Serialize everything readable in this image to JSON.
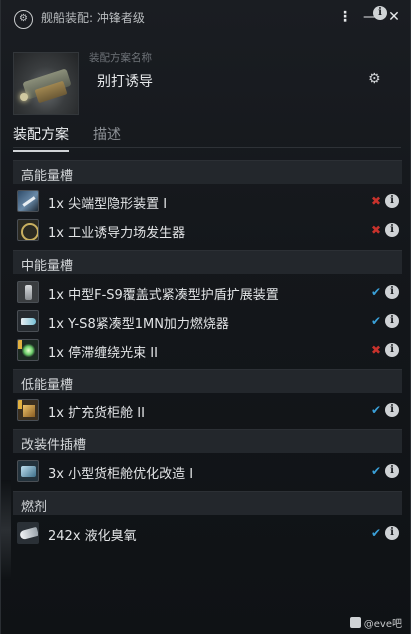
{
  "window": {
    "title": "舰船装配: 冲锋者级",
    "logo_icon": "fitting-icon"
  },
  "fit": {
    "label": "装配方案名称",
    "name": "别打诱导"
  },
  "tabs": [
    {
      "label": "装配方案",
      "active": true
    },
    {
      "label": "描述",
      "active": false
    }
  ],
  "sections": [
    {
      "title": "高能量槽",
      "items": [
        {
          "text": "1x 尖端型隐形装置 I",
          "icon": "cloak-icon",
          "status": "invalid"
        },
        {
          "text": "1x 工业诱导力场发生器",
          "icon": "field-generator-icon",
          "status": "invalid"
        }
      ]
    },
    {
      "title": "中能量槽",
      "items": [
        {
          "text": "1x 中型F-S9覆盖式紧凑型护盾扩展装置",
          "icon": "shield-extender-icon",
          "status": "valid"
        },
        {
          "text": "1x Y-S8紧凑型1MN加力燃烧器",
          "icon": "afterburner-icon",
          "status": "valid"
        },
        {
          "text": "1x 停滞缠绕光束 II",
          "icon": "stasis-web-icon",
          "status": "invalid"
        }
      ]
    },
    {
      "title": "低能量槽",
      "items": [
        {
          "text": "1x 扩充货柜舱 II",
          "icon": "cargo-expander-icon",
          "status": "valid"
        }
      ]
    },
    {
      "title": "改装件插槽",
      "items": [
        {
          "text": "3x 小型货柜舱优化改造 I",
          "icon": "rig-icon",
          "status": "valid"
        }
      ]
    },
    {
      "title": "燃剂",
      "items": [
        {
          "text": "242x 液化臭氧",
          "icon": "ozone-icon",
          "status": "valid"
        }
      ]
    }
  ],
  "symbols": {
    "valid": "✔",
    "invalid": "✖",
    "info": "i"
  },
  "watermark": "@eve吧",
  "colors": {
    "valid": "#3aa0d8",
    "invalid": "#c8322c"
  }
}
